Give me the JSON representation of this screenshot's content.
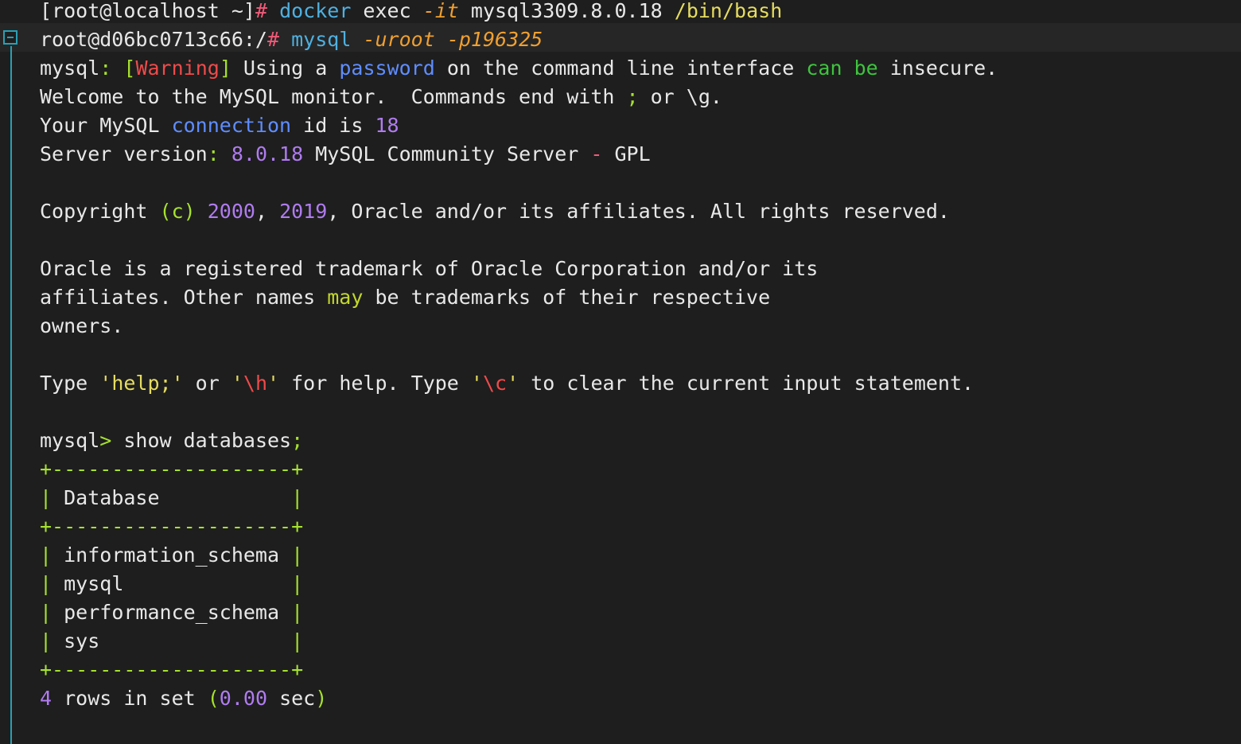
{
  "terminal": {
    "lines": [
      [
        {
          "t": "[root@localhost ~]",
          "c": "white"
        },
        {
          "t": "#",
          "c": "pink"
        },
        {
          "t": " ",
          "c": "white"
        },
        {
          "t": "docker",
          "c": "cyan"
        },
        {
          "t": " exec ",
          "c": "white"
        },
        {
          "t": "-it",
          "c": "orange",
          "i": true
        },
        {
          "t": " mysql3309.8.0.18 ",
          "c": "white"
        },
        {
          "t": "/bin/bash",
          "c": "yellow"
        }
      ],
      [
        {
          "t": "root@d06bc0713c66:/",
          "c": "white"
        },
        {
          "t": "#",
          "c": "pink"
        },
        {
          "t": " ",
          "c": "white"
        },
        {
          "t": "mysql",
          "c": "cyan"
        },
        {
          "t": " ",
          "c": "white"
        },
        {
          "t": "-uroot",
          "c": "orange",
          "i": true
        },
        {
          "t": " ",
          "c": "white"
        },
        {
          "t": "-p196325",
          "c": "orange",
          "i": true
        }
      ],
      [
        {
          "t": "mysql",
          "c": "white"
        },
        {
          "t": ":",
          "c": "lime"
        },
        {
          "t": " ",
          "c": "white"
        },
        {
          "t": "[",
          "c": "lime"
        },
        {
          "t": "Warning",
          "c": "red"
        },
        {
          "t": "]",
          "c": "lime"
        },
        {
          "t": " Using a ",
          "c": "white"
        },
        {
          "t": "password",
          "c": "blue"
        },
        {
          "t": " on the command line interface ",
          "c": "white"
        },
        {
          "t": "can be",
          "c": "green"
        },
        {
          "t": " insecure.",
          "c": "white"
        }
      ],
      [
        {
          "t": "Welcome to the MySQL monitor.  Commands end with ",
          "c": "white"
        },
        {
          "t": ";",
          "c": "lime"
        },
        {
          "t": " or \\g.",
          "c": "white"
        }
      ],
      [
        {
          "t": "Your MySQL ",
          "c": "white"
        },
        {
          "t": "connection",
          "c": "blue"
        },
        {
          "t": " id is ",
          "c": "white"
        },
        {
          "t": "18",
          "c": "purple"
        }
      ],
      [
        {
          "t": "Server version",
          "c": "white"
        },
        {
          "t": ":",
          "c": "lime"
        },
        {
          "t": " ",
          "c": "white"
        },
        {
          "t": "8.0.18",
          "c": "purple"
        },
        {
          "t": " MySQL Community Server ",
          "c": "white"
        },
        {
          "t": "-",
          "c": "pink"
        },
        {
          "t": " GPL",
          "c": "white"
        }
      ],
      [],
      [
        {
          "t": "Copyright ",
          "c": "white"
        },
        {
          "t": "(c)",
          "c": "lime"
        },
        {
          "t": " ",
          "c": "white"
        },
        {
          "t": "2000",
          "c": "purple"
        },
        {
          "t": ", ",
          "c": "white"
        },
        {
          "t": "2019",
          "c": "purple"
        },
        {
          "t": ", Oracle and/or its affiliates. All rights reserved.",
          "c": "white"
        }
      ],
      [],
      [
        {
          "t": "Oracle is a registered trademark of Oracle Corporation and/or its",
          "c": "white"
        }
      ],
      [
        {
          "t": "affiliates. Other names ",
          "c": "white"
        },
        {
          "t": "may",
          "c": "ygreen"
        },
        {
          "t": " be trademarks of their respective",
          "c": "white"
        }
      ],
      [
        {
          "t": "owners.",
          "c": "white"
        }
      ],
      [],
      [
        {
          "t": "Type ",
          "c": "white"
        },
        {
          "t": "'help;'",
          "c": "yellow"
        },
        {
          "t": " or ",
          "c": "white"
        },
        {
          "t": "'",
          "c": "yellow"
        },
        {
          "t": "\\h",
          "c": "red"
        },
        {
          "t": "'",
          "c": "yellow"
        },
        {
          "t": " for help. Type ",
          "c": "white"
        },
        {
          "t": "'",
          "c": "yellow"
        },
        {
          "t": "\\c",
          "c": "red"
        },
        {
          "t": "'",
          "c": "yellow"
        },
        {
          "t": " to clear the current input statement.",
          "c": "white"
        }
      ],
      [],
      [
        {
          "t": "mysql",
          "c": "white"
        },
        {
          "t": ">",
          "c": "lime"
        },
        {
          "t": " show databases",
          "c": "white"
        },
        {
          "t": ";",
          "c": "lime"
        }
      ],
      [
        {
          "t": "+--------------------+",
          "c": "lime"
        }
      ],
      [
        {
          "t": "|",
          "c": "lime"
        },
        {
          "t": " Database           ",
          "c": "white"
        },
        {
          "t": "|",
          "c": "lime"
        }
      ],
      [
        {
          "t": "+--------------------+",
          "c": "lime"
        }
      ],
      [
        {
          "t": "|",
          "c": "lime"
        },
        {
          "t": " information_schema ",
          "c": "white"
        },
        {
          "t": "|",
          "c": "lime"
        }
      ],
      [
        {
          "t": "|",
          "c": "lime"
        },
        {
          "t": " mysql              ",
          "c": "white"
        },
        {
          "t": "|",
          "c": "lime"
        }
      ],
      [
        {
          "t": "|",
          "c": "lime"
        },
        {
          "t": " performance_schema ",
          "c": "white"
        },
        {
          "t": "|",
          "c": "lime"
        }
      ],
      [
        {
          "t": "|",
          "c": "lime"
        },
        {
          "t": " sys                ",
          "c": "white"
        },
        {
          "t": "|",
          "c": "lime"
        }
      ],
      [
        {
          "t": "+--------------------+",
          "c": "lime"
        }
      ],
      [
        {
          "t": "4",
          "c": "purple"
        },
        {
          "t": " rows in set ",
          "c": "white"
        },
        {
          "t": "(",
          "c": "lime"
        },
        {
          "t": "0.00",
          "c": "purple"
        },
        {
          "t": " sec",
          "c": "white"
        },
        {
          "t": ")",
          "c": "lime"
        }
      ]
    ]
  },
  "colors": {
    "background": "#1e1e1e",
    "highlight_row": "#262626",
    "gutter": "#2a9fb3",
    "white": "#e8e8e8",
    "pink": "#f05a78",
    "red": "#f04a4a",
    "blue": "#5f8dff",
    "cyan": "#4fb0e0",
    "orange": "#f0a030",
    "yellow": "#e6dc60",
    "green": "#3ec43e",
    "lime": "#a6e22e",
    "purple": "#b07cf0",
    "ygreen": "#c3d82a"
  },
  "icons": {
    "fold_marker": "collapse-square-icon"
  }
}
